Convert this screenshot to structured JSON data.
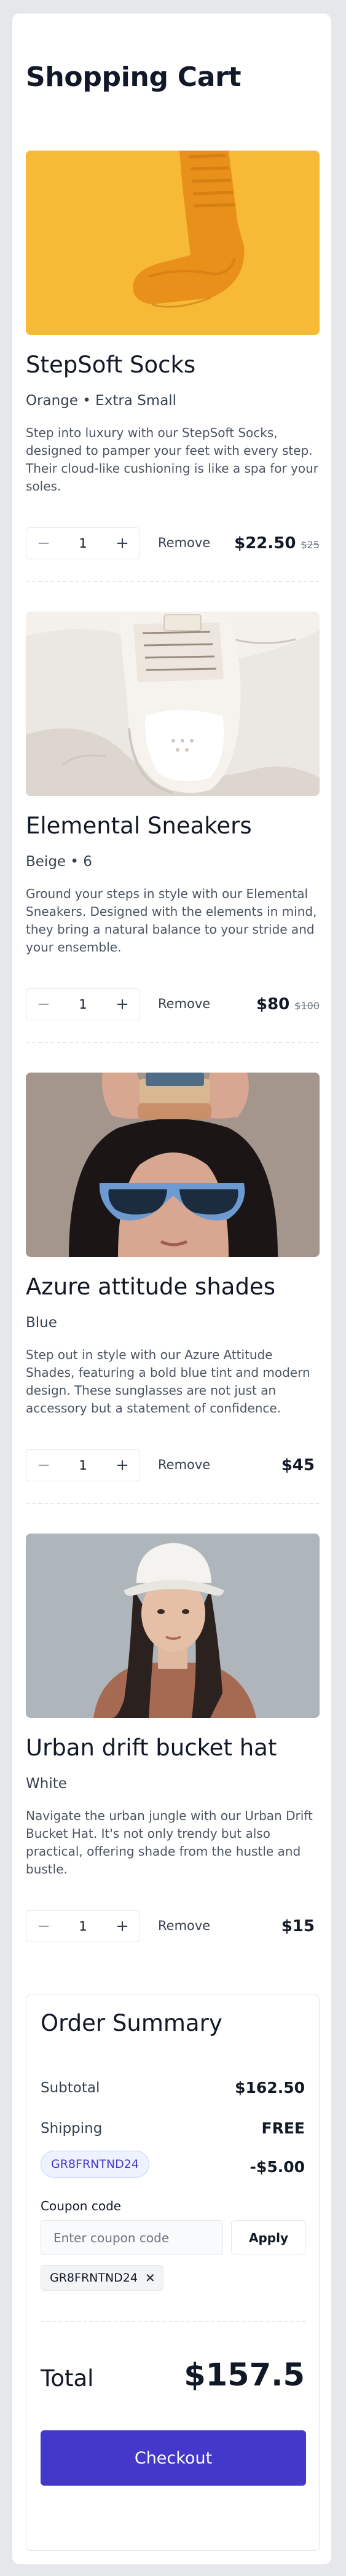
{
  "page": {
    "title": "Shopping Cart"
  },
  "cart": {
    "items": [
      {
        "name": "StepSoft Socks",
        "variant": "Orange • Extra Small",
        "description": "Step into luxury with our StepSoft Socks, designed to pamper your feet with every step. Their cloud-like cushioning is like a spa for your soles.",
        "quantity": "1",
        "minus_icon": "minus-icon",
        "plus_icon": "plus-icon",
        "remove_label": "Remove",
        "price": "$22.50",
        "original_price": "$25",
        "image_subject": "orange socks on orange background"
      },
      {
        "name": "Elemental Sneakers",
        "variant": "Beige • 6",
        "description": "Ground your steps in style with our Elemental Sneakers. Designed with the elements in mind, they bring a natural balance to your stride and your ensemble.",
        "quantity": "1",
        "minus_icon": "minus-icon",
        "plus_icon": "plus-icon",
        "remove_label": "Remove",
        "price": "$80",
        "original_price": "$100",
        "image_subject": "beige sneaker on white fabric"
      },
      {
        "name": "Azure attitude shades",
        "variant": "Blue",
        "description": "Step out in style with our Azure Attitude Shades, featuring a bold blue tint and modern design. These sunglasses are not just an accessory but a statement of confidence.",
        "quantity": "1",
        "minus_icon": "minus-icon",
        "plus_icon": "plus-icon",
        "remove_label": "Remove",
        "price": "$45",
        "original_price": "",
        "image_subject": "woman wearing blue sunglasses"
      },
      {
        "name": "Urban drift bucket hat",
        "variant": "White",
        "description": "Navigate the urban jungle with our Urban Drift Bucket Hat. It's not only trendy but also practical, offering shade from the hustle and bustle.",
        "quantity": "1",
        "minus_icon": "minus-icon",
        "plus_icon": "plus-icon",
        "remove_label": "Remove",
        "price": "$15",
        "original_price": "",
        "image_subject": "woman wearing white bucket hat"
      }
    ]
  },
  "summary": {
    "title": "Order Summary",
    "subtotal_label": "Subtotal",
    "subtotal_value": "$162.50",
    "shipping_label": "Shipping",
    "shipping_value": "FREE",
    "discount_code": "GR8FRNTND24",
    "discount_value": "-$5.00",
    "coupon_label": "Coupon code",
    "coupon_placeholder": "Enter coupon code",
    "apply_label": "Apply",
    "applied_coupon": "GR8FRNTND24",
    "remove_coupon_icon": "close-icon",
    "total_label": "Total",
    "total_value": "$157.5",
    "checkout_label": "Checkout"
  },
  "colors": {
    "accent": "#4338ca",
    "page_background": "#e5e7eb",
    "card_background": "#ffffff",
    "text_primary": "#111827",
    "text_secondary": "#4b5563",
    "badge_background": "#eef2ff"
  }
}
